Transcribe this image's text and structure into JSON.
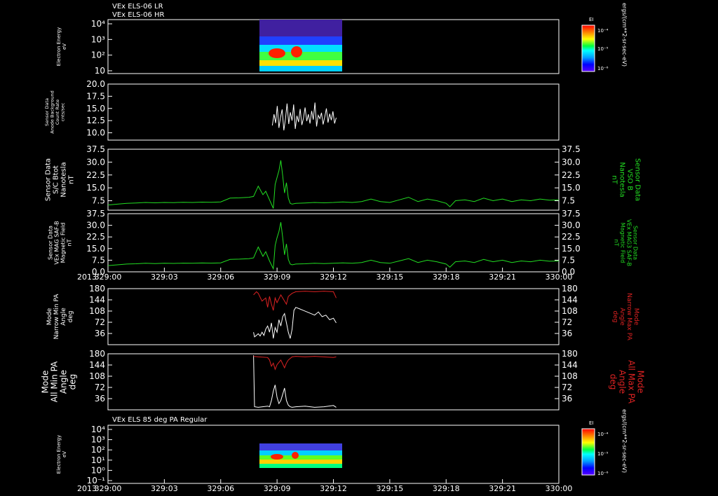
{
  "titles": {
    "top1": "VEx ELS-06 LR",
    "top2": "VEx ELS-06 HR",
    "mid": "VEx ELS 85 deg PA Regular"
  },
  "colorbar": {
    "label": "EI",
    "ticks": [
      "10⁻⁴",
      "10⁻⁵",
      "10⁻⁶"
    ],
    "units": "ergs/(cm**2-sr-sec-eV)"
  },
  "colors": {
    "background": "#000000",
    "frame": "#ffffff",
    "field": "#22dd22",
    "maxpa": "#dd2222",
    "minpa": "#ffffff"
  },
  "chart_data": [
    {
      "type": "heatmap",
      "ylabel": [
        "Electron Energy",
        "eV"
      ],
      "yscale": "log",
      "ytick_labels": [
        "10⁴",
        "10³",
        "10²",
        "10"
      ],
      "data_span": [
        "329:07:45",
        "329:12:10"
      ],
      "peak_times": [
        "329:08:10",
        "329:09:20"
      ]
    },
    {
      "type": "line",
      "ylabel": [
        "Sensor Data",
        "Anode Background",
        "Count Rate",
        "cnts/sec"
      ],
      "ylim": [
        8.5,
        20.0
      ],
      "ytick_labels": [
        "20.0",
        "17.5",
        "15.0",
        "12.5",
        "10.0"
      ],
      "series": [
        {
          "values": [
            11.5,
            13.8,
            12.0,
            15.5,
            11.0,
            13.2,
            14.8,
            10.5,
            12.8,
            16.0,
            11.8,
            14.2,
            12.5,
            15.8,
            10.8,
            13.5,
            12.2,
            14.9,
            11.6,
            13.0,
            15.2,
            12.4,
            13.8,
            11.9,
            14.5,
            12.7,
            16.2,
            11.3,
            13.6,
            12.9,
            14.1,
            11.7,
            13.3,
            15.0,
            12.1,
            13.9,
            12.6,
            14.4,
            11.9,
            13.1
          ]
        }
      ]
    },
    {
      "type": "line",
      "ylabel": [
        "Sensor Data",
        "S/C Btot",
        "Nanotesla",
        "nT"
      ],
      "ylabel_right": [
        "Sensor Data",
        "VSO B",
        "Nanotesla",
        "nT"
      ],
      "ylim": [
        2.0,
        37.5
      ],
      "ytick_labels": [
        "37.5",
        "30.0",
        "22.5",
        "15.0",
        "7.5"
      ],
      "series": [
        {
          "times": [
            0,
            0.5,
            1,
            1.5,
            2,
            2.5,
            3,
            3.5,
            4,
            4.5,
            5,
            5.5,
            6,
            6.5,
            7,
            7.5,
            7.75,
            8,
            8.25,
            8.4,
            8.6,
            8.8,
            8.9,
            9.0,
            9.1,
            9.2,
            9.3,
            9.4,
            9.5,
            9.6,
            9.7,
            9.8,
            10,
            10.5,
            11,
            11.5,
            12,
            12.5,
            13,
            13.5,
            14,
            14.5,
            15,
            15.5,
            16,
            16.5,
            17,
            17.5,
            18,
            18.2,
            18.5,
            19,
            19.5,
            20,
            20.5,
            21,
            21.5,
            22,
            22.5,
            23,
            23.5,
            24
          ],
          "values": [
            5,
            5.5,
            6,
            6.2,
            6.5,
            6.3,
            6.5,
            6.4,
            6.6,
            6.5,
            6.7,
            6.6,
            6.8,
            9,
            9.2,
            9.5,
            10,
            16,
            11,
            13,
            8,
            3,
            17,
            21,
            25,
            31,
            22,
            12,
            18,
            9,
            6,
            5.5,
            6,
            6.2,
            6.5,
            6.3,
            6.5,
            6.8,
            6.5,
            7,
            8.5,
            7,
            6.5,
            8,
            9.5,
            7,
            8.5,
            7.5,
            6,
            4,
            7.5,
            8,
            7,
            9,
            7.5,
            8.5,
            7,
            8,
            7.5,
            8.5,
            7.8,
            8
          ]
        }
      ]
    },
    {
      "type": "line",
      "ylabel": [
        "Sensor Data",
        "VEx MAG SAF-B",
        "Magnetic Field",
        "nT"
      ],
      "ylabel_right": [
        "Sensor Data",
        "VEx MAG3 SAF-B",
        "Magnetic Field",
        "nT"
      ],
      "ylim": [
        0.0,
        37.5
      ],
      "ytick_labels": [
        "37.5",
        "30.0",
        "22.5",
        "15.0",
        "7.5",
        "0.0"
      ],
      "xtick_labels": [
        "2013",
        "329:00",
        "329:03",
        "329:06",
        "329:09",
        "329:12",
        "329:15",
        "329:18",
        "329:21",
        "330:00"
      ],
      "series": [
        {
          "times": [
            0,
            0.5,
            1,
            1.5,
            2,
            2.5,
            3,
            3.5,
            4,
            4.5,
            5,
            5.5,
            6,
            6.5,
            7,
            7.5,
            7.75,
            8,
            8.25,
            8.4,
            8.6,
            8.8,
            8.9,
            9.0,
            9.1,
            9.2,
            9.3,
            9.4,
            9.5,
            9.6,
            9.7,
            9.8,
            10,
            10.5,
            11,
            11.5,
            12,
            12.5,
            13,
            13.5,
            14,
            14.5,
            15,
            15.5,
            16,
            16.5,
            17,
            17.5,
            18,
            18.2,
            18.5,
            19,
            19.5,
            20,
            20.5,
            21,
            21.5,
            22,
            22.5,
            23,
            23.5,
            24
          ],
          "values": [
            4,
            4.5,
            5,
            5.2,
            5.5,
            5.3,
            5.5,
            5.4,
            5.6,
            5.5,
            5.7,
            5.6,
            5.8,
            8,
            8.2,
            8.5,
            9,
            16,
            10,
            13,
            7,
            2,
            17,
            22,
            26,
            32,
            22,
            11,
            18,
            8,
            5,
            4.5,
            5,
            5.2,
            5.5,
            5.3,
            5.5,
            5.8,
            5.5,
            6,
            7.5,
            6,
            5.5,
            7,
            8.5,
            6,
            7.5,
            6.5,
            5,
            3,
            6.5,
            7,
            6,
            8,
            6.5,
            7.5,
            6,
            7,
            6.5,
            7.5,
            6.8,
            7
          ]
        }
      ]
    },
    {
      "type": "line",
      "ylabel": [
        "Mode",
        "Narrow Min PA",
        "Angle",
        "deg"
      ],
      "ylabel_right": [
        "Mode",
        "Narrow Max PA",
        "Angle",
        "deg"
      ],
      "ylim": [
        0,
        180
      ],
      "ytick_labels": [
        "180",
        "144",
        "108",
        "72",
        "36"
      ],
      "series": [
        {
          "name": "min",
          "times": [
            7.75,
            7.8,
            7.9,
            8.0,
            8.1,
            8.2,
            8.3,
            8.4,
            8.5,
            8.6,
            8.7,
            8.8,
            8.9,
            9.0,
            9.1,
            9.2,
            9.3,
            9.4,
            9.5,
            9.6,
            9.7,
            9.8,
            9.9,
            10.0,
            10.2,
            10.4,
            10.6,
            10.8,
            11.0,
            11.2,
            11.4,
            11.6,
            11.8,
            12.0,
            12.15
          ],
          "values": [
            40,
            25,
            30,
            35,
            28,
            40,
            30,
            50,
            60,
            40,
            70,
            20,
            55,
            40,
            80,
            60,
            90,
            100,
            70,
            40,
            20,
            50,
            110,
            120,
            115,
            110,
            105,
            100,
            95,
            105,
            90,
            95,
            80,
            85,
            70
          ]
        },
        {
          "name": "max",
          "times": [
            7.75,
            7.9,
            8.0,
            8.2,
            8.4,
            8.5,
            8.6,
            8.7,
            8.8,
            8.9,
            9.0,
            9.2,
            9.4,
            9.5,
            9.6,
            9.8,
            10.0,
            10.5,
            11.0,
            11.5,
            12.0,
            12.15
          ],
          "values": [
            160,
            170,
            165,
            140,
            150,
            120,
            155,
            130,
            110,
            150,
            135,
            160,
            140,
            130,
            155,
            165,
            170,
            172,
            170,
            172,
            170,
            150
          ]
        }
      ]
    },
    {
      "type": "line",
      "ylabel": [
        "Mode",
        "All Min PA",
        "Angle",
        "deg"
      ],
      "ylabel_right": [
        "Mode",
        "All Max PA",
        "Angle",
        "deg"
      ],
      "ylim": [
        0,
        180
      ],
      "ytick_labels": [
        "180",
        "144",
        "108",
        "72",
        "36"
      ],
      "series": [
        {
          "name": "min",
          "times": [
            7.75,
            7.8,
            8.0,
            8.5,
            8.6,
            8.7,
            8.8,
            8.9,
            9.0,
            9.1,
            9.2,
            9.3,
            9.4,
            9.5,
            9.6,
            9.7,
            9.8,
            10.0,
            10.5,
            11.0,
            11.5,
            12.0,
            12.15
          ],
          "values": [
            175,
            10,
            8,
            12,
            10,
            30,
            60,
            80,
            40,
            20,
            30,
            50,
            70,
            30,
            15,
            10,
            8,
            10,
            12,
            8,
            10,
            14,
            8
          ]
        },
        {
          "name": "max",
          "times": [
            7.75,
            8.0,
            8.5,
            8.6,
            8.7,
            8.8,
            8.9,
            9.0,
            9.2,
            9.4,
            9.5,
            9.6,
            9.8,
            10.0,
            10.5,
            11.0,
            12.0,
            12.15
          ],
          "values": [
            172,
            170,
            168,
            160,
            140,
            150,
            130,
            145,
            160,
            135,
            150,
            160,
            170,
            172,
            170,
            172,
            168,
            170
          ]
        }
      ]
    },
    {
      "type": "heatmap",
      "ylabel": [
        "Electron Energy",
        "eV"
      ],
      "yscale": "log",
      "ytick_labels": [
        "10⁴",
        "10³",
        "10²",
        "10¹",
        "10⁰",
        "10⁻¹"
      ],
      "xtick_labels": [
        "2013",
        "329:00",
        "329:03",
        "329:06",
        "329:09",
        "329:12",
        "329:15",
        "329:18",
        "329:21",
        "330:00"
      ],
      "data_span": [
        "329:07:45",
        "329:12:10"
      ]
    }
  ]
}
